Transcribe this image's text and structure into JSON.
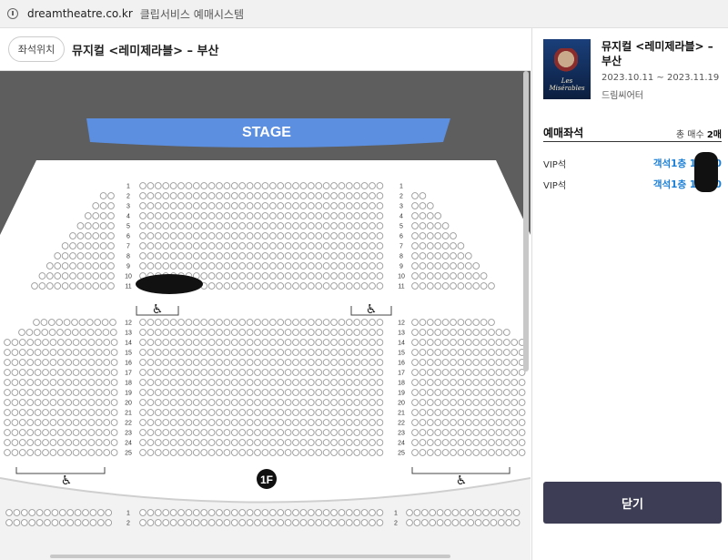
{
  "browser": {
    "domain": "dreamtheatre.co.kr",
    "page_title": "클립서비스 예매시스템"
  },
  "header": {
    "seat_position_button": "좌석위치",
    "title": "뮤지컬 <레미제라블> – 부산"
  },
  "seatmap": {
    "stage_label": "STAGE",
    "floor_badge": "1F",
    "row_labels_upper": [
      "1",
      "2",
      "3",
      "4",
      "5",
      "6",
      "7",
      "8",
      "9",
      "10",
      "11"
    ],
    "row_labels_lower": [
      "12",
      "13",
      "14",
      "15",
      "16",
      "17",
      "18",
      "19",
      "20",
      "21",
      "22",
      "23",
      "24",
      "25"
    ],
    "row_labels_balcony": [
      "1",
      "2"
    ],
    "colors": {
      "stage": "#5c8fe0",
      "background": "#5e5e5e",
      "floor": "#ffffff",
      "seat_outline": "#9a9a9a"
    }
  },
  "show": {
    "title": "뮤지컬 <레미제라블> – 부산",
    "dates": "2023.10.11 ~ 2023.11.19",
    "venue": "드림씨어터",
    "poster_text": "Les Misérables"
  },
  "selection": {
    "title": "예매좌석",
    "count_label": "총 매수",
    "count_value": "2매",
    "seats": [
      {
        "grade": "VIP석",
        "location": "객석1층 11열 0"
      },
      {
        "grade": "VIP석",
        "location": "객석1층 11열 0"
      }
    ]
  },
  "actions": {
    "close_label": "닫기"
  }
}
